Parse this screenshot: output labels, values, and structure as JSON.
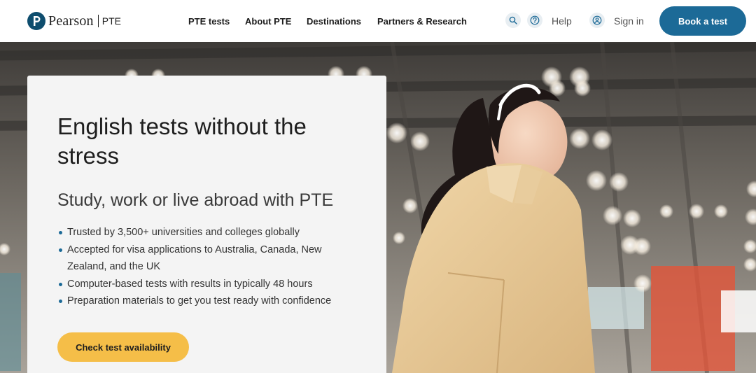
{
  "brand": {
    "name": "Pearson",
    "product": "PTE"
  },
  "nav": {
    "items": [
      {
        "label": "PTE tests"
      },
      {
        "label": "About PTE"
      },
      {
        "label": "Destinations"
      },
      {
        "label": "Partners & Research"
      }
    ]
  },
  "utility": {
    "search_icon": "search-icon",
    "help_icon": "help-icon",
    "help_label": "Help",
    "account_icon": "user-icon",
    "signin_label": "Sign in",
    "book_label": "Book a test"
  },
  "hero": {
    "title": "English tests without the stress",
    "subtitle": "Study, work or live abroad with PTE",
    "bullets": [
      "Trusted by 3,500+ universities and colleges globally",
      "Accepted for visa applications to Australia, Canada, New Zealand, and the UK",
      "Computer-based tests with results in typically 48 hours",
      "Preparation materials to get you test ready with confidence"
    ],
    "cta_label": "Check test availability"
  },
  "colors": {
    "primary": "#1c6a97",
    "cta": "#f5be48",
    "card": "#f4f4f4"
  }
}
